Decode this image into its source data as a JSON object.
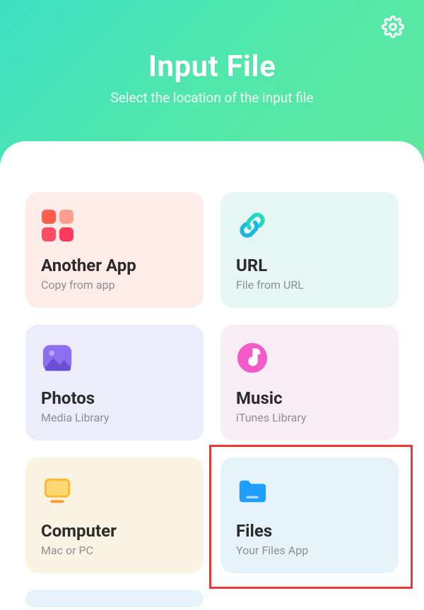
{
  "header": {
    "title": "Input File",
    "subtitle": "Select the location of the input file"
  },
  "cards": [
    {
      "title": "Another App",
      "subtitle": "Copy from app"
    },
    {
      "title": "URL",
      "subtitle": "File from URL"
    },
    {
      "title": "Photos",
      "subtitle": "Media Library"
    },
    {
      "title": "Music",
      "subtitle": "iTunes Library"
    },
    {
      "title": "Computer",
      "subtitle": "Mac or PC"
    },
    {
      "title": "Files",
      "subtitle": "Your Files App"
    }
  ]
}
